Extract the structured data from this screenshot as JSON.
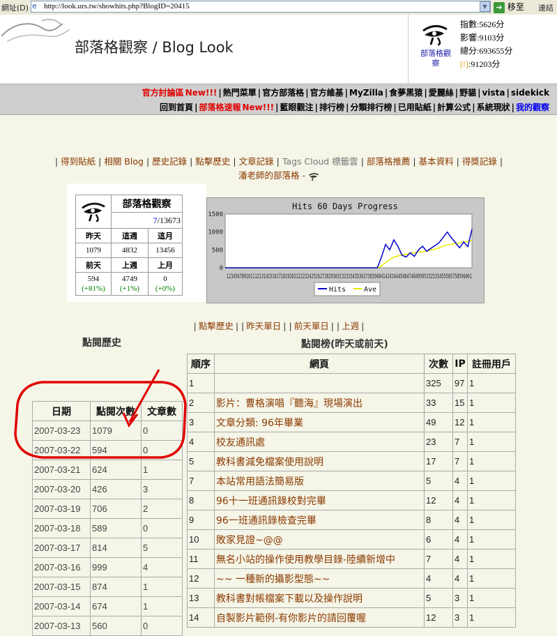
{
  "browser": {
    "address_label": "網址(D)",
    "url": "http://look.urs.tw/showhits.php?BlogID=20415",
    "go_label": "移至",
    "links_label": "連結"
  },
  "header": {
    "title": "部落格觀察 / Blog Look",
    "logo_caption": "部落格觀察",
    "stats": [
      "指數:5626分",
      "影響:9103分",
      "總分:693655分"
    ],
    "bang": "[!]",
    "bang_value": ":91203分"
  },
  "nav": {
    "row1": [
      {
        "label": "官方討論區",
        "style": "red"
      },
      {
        "label": "New!!!",
        "style": "red"
      },
      {
        "label": "|"
      },
      {
        "label": "熱門菜單"
      },
      {
        "label": "|"
      },
      {
        "label": "官方部落格"
      },
      {
        "label": "|"
      },
      {
        "label": "官方維基"
      },
      {
        "label": "|"
      },
      {
        "label": "MyZilla"
      },
      {
        "label": "|"
      },
      {
        "label": "食夢黑猿"
      },
      {
        "label": "|"
      },
      {
        "label": "愛麗絲"
      },
      {
        "label": "|"
      },
      {
        "label": "野貓"
      },
      {
        "label": "|"
      },
      {
        "label": "vista"
      },
      {
        "label": "|"
      },
      {
        "label": "sidekick"
      }
    ],
    "row2": [
      {
        "label": "回到首頁"
      },
      {
        "label": "|"
      },
      {
        "label": "部落格速報",
        "style": "red"
      },
      {
        "label": "New!!!",
        "style": "red"
      },
      {
        "label": "|"
      },
      {
        "label": "藍眼觀注"
      },
      {
        "label": "|"
      },
      {
        "label": "排行榜"
      },
      {
        "label": "|"
      },
      {
        "label": "分類排行榜"
      },
      {
        "label": "|"
      },
      {
        "label": "已用貼紙"
      },
      {
        "label": "|"
      },
      {
        "label": "計算公式"
      },
      {
        "label": "|"
      },
      {
        "label": "系統現狀"
      },
      {
        "label": "|"
      },
      {
        "label": "我的觀察",
        "style": "blue"
      }
    ]
  },
  "tabs": {
    "items": [
      "得到貼紙",
      "相關 Blog",
      "歷史記錄",
      "點擊歷史",
      "文章記錄",
      "Tags Cloud 標籤雲",
      "部落格推薦",
      "基本資料",
      "得獎記錄"
    ],
    "blog_name": "潘老師的部落格 - "
  },
  "card": {
    "title": "部落格觀察",
    "rank": "7",
    "rank_total": "/13673",
    "headers1": [
      "昨天",
      "這週",
      "這月"
    ],
    "values1": [
      "1079",
      "4832",
      "13456"
    ],
    "headers2": [
      "前天",
      "上週",
      "上月"
    ],
    "values2": [
      "594",
      "4749",
      "0"
    ],
    "changes": [
      "(+81%)",
      "(+1%)",
      "(+0%)"
    ]
  },
  "chart_data": {
    "type": "line",
    "title": "Hits 60 Days Progress",
    "ylim": [
      0,
      1500
    ],
    "yticks": [
      0,
      500,
      1000,
      1500
    ],
    "xtick_text": "12345678910111213141516171819202122232425262728293031323334353637383940414243444546474849505152535455565758596061",
    "x": [
      1,
      2,
      3,
      4,
      5,
      6,
      7,
      8,
      9,
      10,
      11,
      12,
      13,
      14,
      15,
      16,
      17,
      18,
      19,
      20,
      21,
      22,
      23,
      24,
      25,
      26,
      27,
      28,
      29,
      30,
      31,
      32,
      33,
      34,
      35,
      36,
      37,
      38,
      39,
      40,
      41,
      42,
      43,
      44,
      45,
      46,
      47,
      48,
      49,
      50,
      51,
      52,
      53,
      54,
      55,
      56,
      57,
      58,
      59,
      60,
      61
    ],
    "series": [
      {
        "name": "Hits",
        "color": "#0000cc",
        "values": [
          0,
          0,
          0,
          0,
          0,
          0,
          0,
          0,
          0,
          0,
          0,
          0,
          0,
          0,
          0,
          0,
          0,
          0,
          0,
          0,
          0,
          0,
          0,
          0,
          0,
          0,
          0,
          0,
          0,
          0,
          0,
          0,
          0,
          0,
          0,
          0,
          0,
          0,
          300,
          650,
          500,
          780,
          600,
          350,
          300,
          420,
          320,
          500,
          600,
          460,
          540,
          620,
          700,
          850,
          1000,
          840,
          700,
          560,
          720,
          590,
          1079
        ]
      },
      {
        "name": "Ave",
        "color": "#e8e800",
        "values": [
          0,
          0,
          0,
          0,
          0,
          0,
          0,
          0,
          0,
          0,
          0,
          0,
          0,
          0,
          0,
          0,
          0,
          0,
          0,
          0,
          0,
          0,
          0,
          0,
          0,
          0,
          0,
          0,
          0,
          0,
          0,
          0,
          0,
          0,
          0,
          0,
          0,
          0,
          50,
          150,
          230,
          300,
          330,
          360,
          370,
          400,
          420,
          440,
          450,
          470,
          500,
          520,
          560,
          600,
          640,
          660,
          680,
          700,
          720,
          740,
          760
        ]
      }
    ]
  },
  "sublinks": {
    "items": [
      "點擊歷史",
      "昨天單日",
      "前天單日",
      "上週"
    ]
  },
  "history": {
    "title": "點閱歷史",
    "headers": [
      "日期",
      "點閱次數",
      "文章數"
    ],
    "rows": [
      [
        "2007-03-23",
        "1079",
        "0"
      ],
      [
        "2007-03-22",
        "594",
        "0"
      ],
      [
        "2007-03-21",
        "624",
        "1"
      ],
      [
        "2007-03-20",
        "426",
        "3"
      ],
      [
        "2007-03-19",
        "706",
        "2"
      ],
      [
        "2007-03-18",
        "589",
        "0"
      ],
      [
        "2007-03-17",
        "814",
        "5"
      ],
      [
        "2007-03-16",
        "999",
        "4"
      ],
      [
        "2007-03-15",
        "874",
        "1"
      ],
      [
        "2007-03-14",
        "674",
        "1"
      ],
      [
        "2007-03-13",
        "560",
        "0"
      ]
    ]
  },
  "ranking": {
    "title": "點閱榜(昨天或前天)",
    "headers": [
      "順序",
      "網頁",
      "次數",
      "IP",
      "註冊用戶"
    ],
    "rows": [
      [
        "1",
        "",
        "325",
        "97",
        "1"
      ],
      [
        "2",
        "影片：曹格演唱『聽海』現場演出",
        "33",
        "15",
        "1"
      ],
      [
        "3",
        "文章分類: 96年畢業",
        "49",
        "12",
        "1"
      ],
      [
        "4",
        "校友通訊處",
        "23",
        "7",
        "1"
      ],
      [
        "5",
        "教科書減免檔案使用說明",
        "17",
        "7",
        "1"
      ],
      [
        "7",
        "本站常用語法簡易版",
        "5",
        "4",
        "1"
      ],
      [
        "8",
        "96十一班通訊錄校對完畢",
        "12",
        "4",
        "1"
      ],
      [
        "9",
        "96一班通訊錄檢查完畢",
        "8",
        "4",
        "1"
      ],
      [
        "10",
        "敗家見證~@@",
        "6",
        "4",
        "1"
      ],
      [
        "11",
        "無名小站的操作使用教學目錄-陸續新增中",
        "7",
        "4",
        "1"
      ],
      [
        "12",
        "~~ 一種新的攝影型態~~",
        "4",
        "4",
        "1"
      ],
      [
        "13",
        "教科書對帳檔案下載以及操作說明",
        "5",
        "3",
        "1"
      ],
      [
        "14",
        "自製影片範例-有你影片的請回覆喔",
        "12",
        "3",
        "1"
      ]
    ]
  },
  "colors": {
    "annotation": "#e00000",
    "link": "#8b3a00",
    "nav_bg": "#cfcfcf"
  }
}
